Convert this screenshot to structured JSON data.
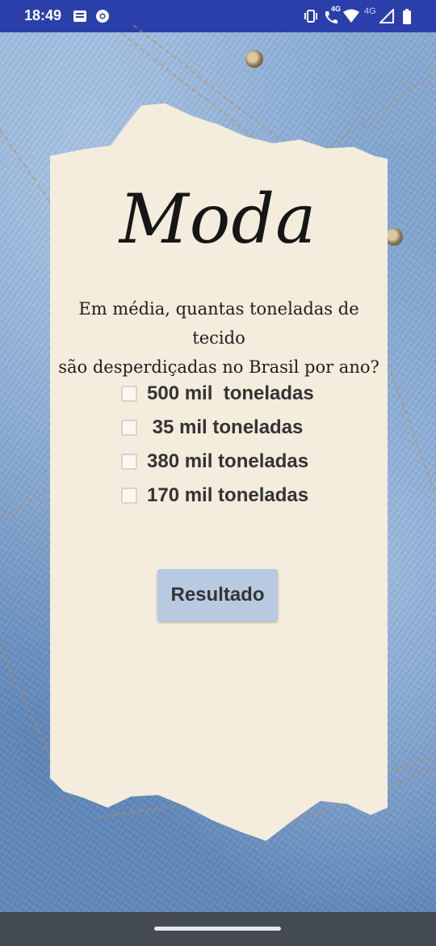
{
  "status_bar": {
    "time": "18:49",
    "network_label": "4G",
    "network_label_2": "4G",
    "icons": [
      "notes-icon",
      "chrome-icon",
      "vibrate-icon",
      "volte-call-icon",
      "wifi-icon",
      "signal-icon",
      "battery-icon"
    ]
  },
  "quiz": {
    "title": "Moda",
    "question_line1": "Em média, quantas toneladas de tecido",
    "question_line2": "são desperdiçadas no Brasil por ano?",
    "options": [
      {
        "label": "500 mil  toneladas",
        "checked": false
      },
      {
        "label": " 35 mil toneladas",
        "checked": false
      },
      {
        "label": "380 mil toneladas",
        "checked": false
      },
      {
        "label": "170 mil toneladas",
        "checked": false
      }
    ],
    "result_button": "Resultado"
  },
  "colors": {
    "status_bar": "#2b3faa",
    "paper": "#f4ecdc",
    "button": "#b9c9e2",
    "nav_bar": "#444a52"
  }
}
